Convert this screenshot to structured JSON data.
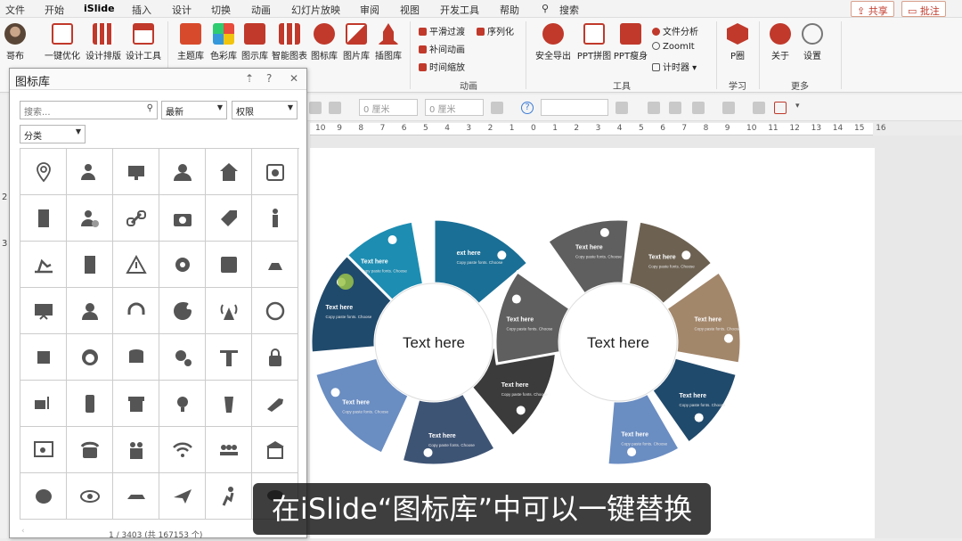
{
  "menubar": {
    "tabs": [
      "文件",
      "开始",
      "iSlide",
      "插入",
      "设计",
      "切换",
      "动画",
      "幻灯片放映",
      "审阅",
      "视图",
      "开发工具",
      "帮助",
      "搜索"
    ],
    "share": "共享",
    "comment": "批注"
  },
  "ribbon": {
    "profile_label": "哥布",
    "buttons": [
      "一键优化",
      "设计排版",
      "设计工具",
      "主题库",
      "色彩库",
      "图示库",
      "智能图表",
      "图标库",
      "图片库",
      "插图库"
    ],
    "anim_items": [
      "平滑过渡",
      "补间动画",
      "时间缩放",
      "序列化"
    ],
    "anim_group": "动画",
    "tools_buttons": [
      "安全导出",
      "PPT拼图",
      "PPT瘦身"
    ],
    "tools_items": [
      "文件分析",
      "ZoomIt",
      "计时器"
    ],
    "tools_group": "工具",
    "learn_button": "P圈",
    "learn_group": "学习",
    "more_buttons": [
      "关于",
      "设置"
    ],
    "more_group": "更多"
  },
  "toolbar2": {
    "unit1": "0 厘米",
    "unit2": "0 厘米"
  },
  "ruler": [
    "10",
    "9",
    "8",
    "7",
    "6",
    "5",
    "4",
    "3",
    "2",
    "1",
    "0",
    "1",
    "2",
    "3",
    "4",
    "5",
    "6",
    "7",
    "8",
    "9",
    "10",
    "11",
    "12",
    "13",
    "14",
    "15",
    "16"
  ],
  "slide_numbers": [
    "2",
    "3"
  ],
  "panel": {
    "title": "图标库",
    "search_placeholder": "搜索...",
    "sort": "最新",
    "permission": "权限",
    "category": "分类",
    "icons": [
      "location-pin",
      "user-gear",
      "presenter-board",
      "users",
      "house-person",
      "calendar",
      "building",
      "user-check",
      "chain-link",
      "camera-gear",
      "tag-rocket",
      "person-standing",
      "oil-pump",
      "office-tower",
      "warning",
      "gear",
      "cdr-file",
      "dentist-chair",
      "presentation",
      "support-agent",
      "headphones",
      "palette",
      "broadcast-tower",
      "24h-service",
      "chip",
      "headset-person",
      "database-download",
      "gears",
      "weightlifter",
      "padlock",
      "forklift",
      "phone-share",
      "shop",
      "lightbulb",
      "drink-cup",
      "trumpet",
      "browser-search",
      "telephone",
      "family",
      "wifi",
      "team-seminar",
      "bank-hand",
      "brain",
      "eye",
      "car",
      "fighter-jet",
      "runner",
      "storm-cloud"
    ],
    "pager": "1 / 3403 (共 167153 个)"
  },
  "slide": {
    "center_left": "Text here",
    "center_right": "Text here",
    "seg_title": "Text here",
    "seg_title_partial": "ext here",
    "seg_body": "Copy paste fonts. Choose the only option to retain text.",
    "colors": [
      "#1a6f96",
      "#1d8db2",
      "#204a6c",
      "#6a8dc2",
      "#3e5475",
      "#3b3b3b",
      "#5f5f5f",
      "#6d6252",
      "#a3876b",
      "#204a6c",
      "#6a8dc2"
    ]
  },
  "subtitle": "在iSlide“图标库”中可以一键替换"
}
